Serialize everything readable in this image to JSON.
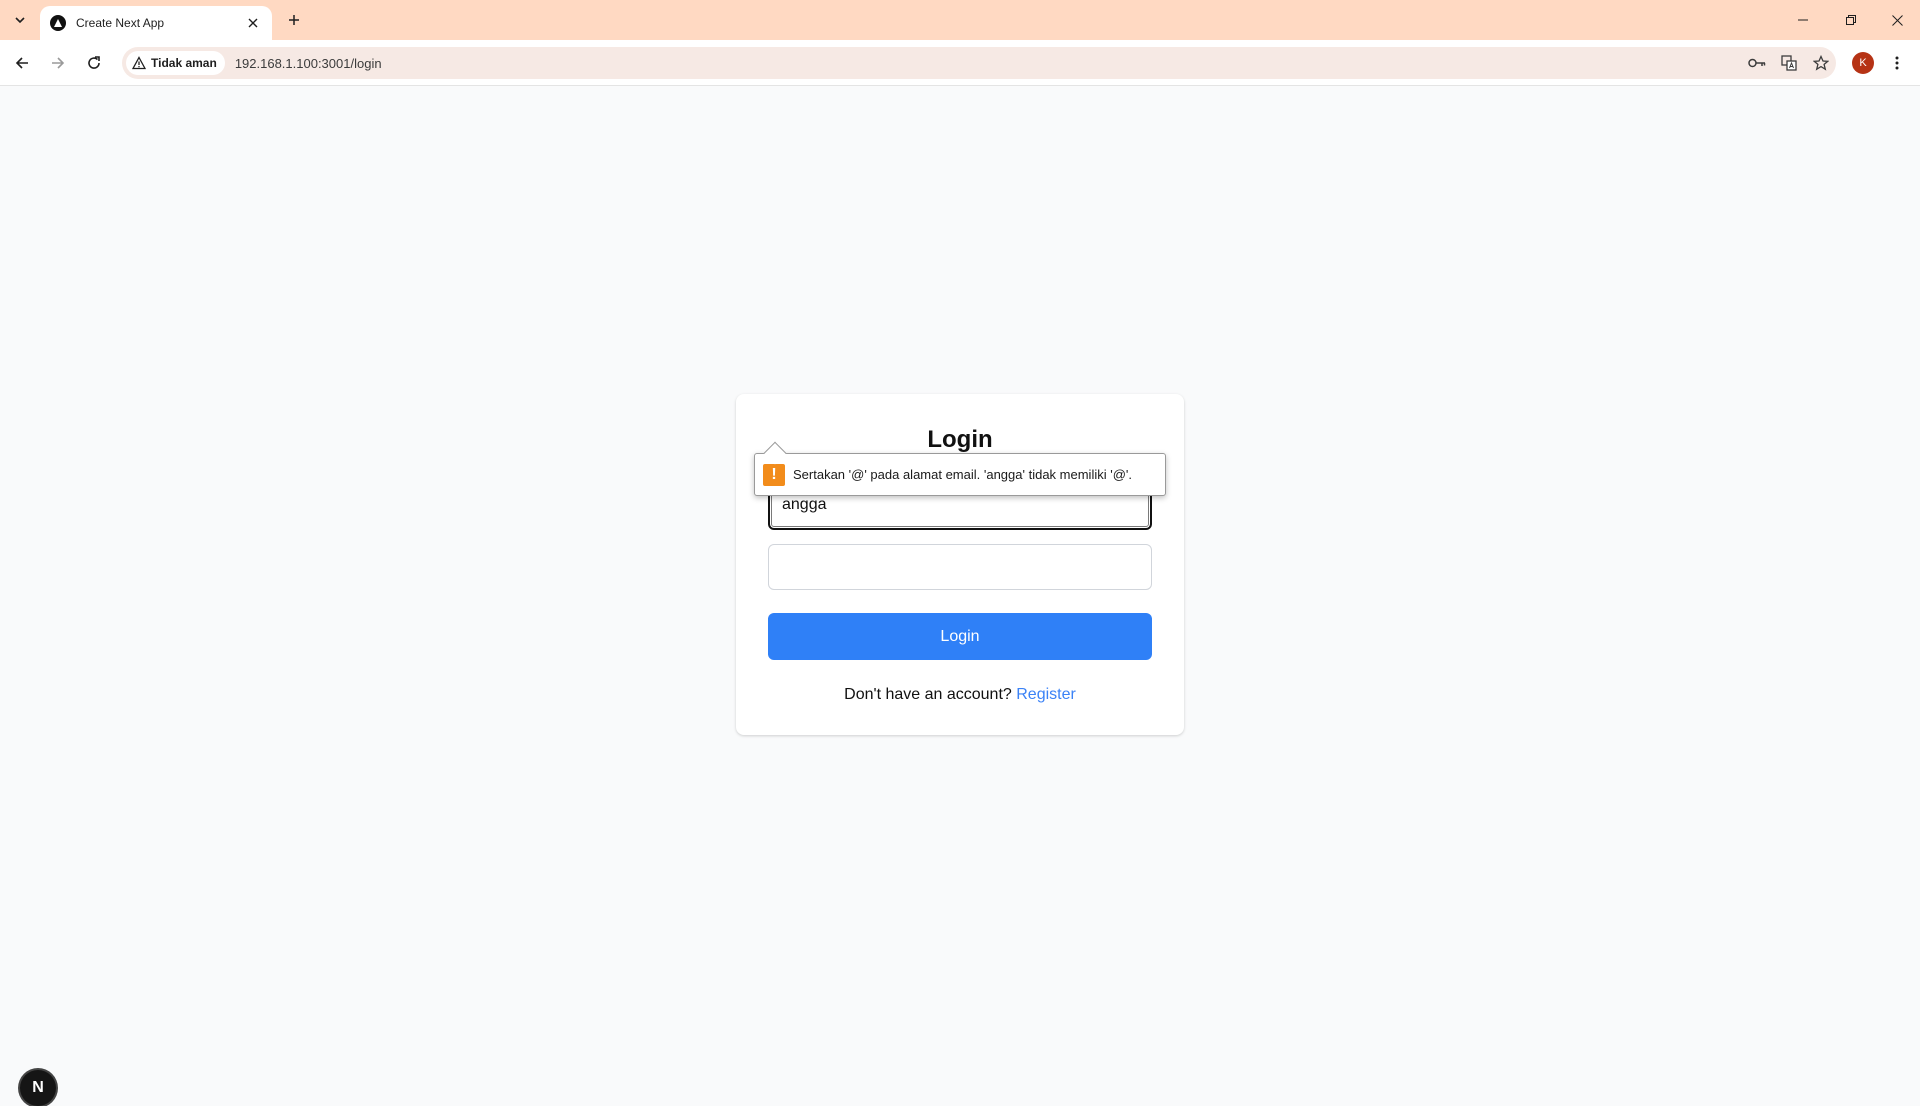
{
  "browser": {
    "tab_title": "Create Next App",
    "security_label": "Tidak aman",
    "url": "192.168.1.100:3001/login",
    "profile_initial": "K"
  },
  "login": {
    "title": "Login",
    "email_value": "angga",
    "password_value": "",
    "submit_label": "Login",
    "register_prompt": "Don't have an account?",
    "register_link": "Register"
  },
  "validation": {
    "message": "Sertakan '@' pada alamat email. 'angga' tidak memiliki '@'."
  },
  "dev_badge": {
    "letter": "N"
  },
  "colors": {
    "tabbar": "#ffd9c2",
    "primary": "#2f80f7",
    "link": "#3b82f6",
    "warning": "#f28c1b"
  }
}
